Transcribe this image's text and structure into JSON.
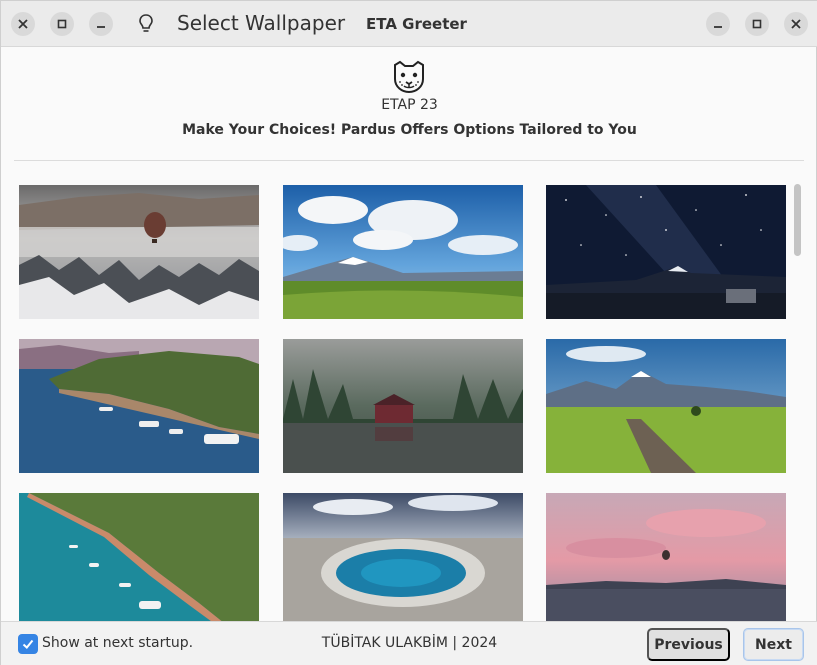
{
  "titlebar": {
    "title": "Select Wallpaper",
    "app_name": "ETA Greeter",
    "left_buttons": [
      "close-icon",
      "maximize-icon",
      "minimize-icon"
    ],
    "right_buttons": [
      "minimize-icon",
      "maximize-icon",
      "close-icon"
    ],
    "hint_icon": "lightbulb-icon"
  },
  "header": {
    "logo": "pardus-leopard-logo",
    "version": "ETAP 23",
    "subtitle": "Make Your Choices! Pardus Offers Options Tailored to You"
  },
  "wallpapers": [
    {
      "name": "cappadocia-balloon-winter"
    },
    {
      "name": "mount-erciyes-clouds"
    },
    {
      "name": "milky-way-mountain-night"
    },
    {
      "name": "bay-with-boats"
    },
    {
      "name": "misty-lake-house"
    },
    {
      "name": "mountain-country-road"
    },
    {
      "name": "aerial-coast-boats"
    },
    {
      "name": "crater-lake-aerial"
    },
    {
      "name": "pink-sky-balloon"
    }
  ],
  "footer": {
    "show_at_startup_label": "Show at next startup.",
    "show_at_startup_checked": true,
    "credit": "TÜBİTAK ULAKBİM | 2024",
    "previous_label": "Previous",
    "next_label": "Next"
  },
  "colors": {
    "accent": "#3584e4",
    "titlebar": "#ebebeb",
    "background": "#fafafa"
  }
}
